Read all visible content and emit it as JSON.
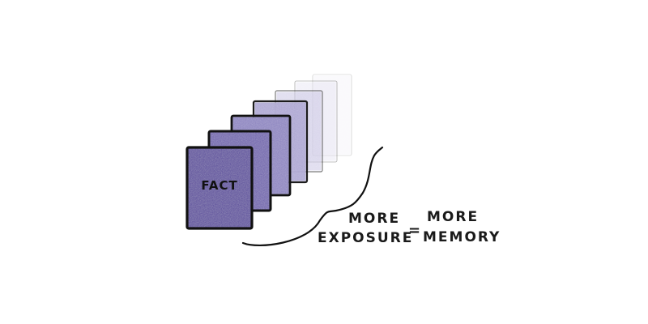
{
  "fact_card": {
    "label": "FACT",
    "color": "#5a4a9c"
  },
  "cards": [
    {
      "color": "#5a4a9c"
    },
    {
      "color": "#6f62ad"
    },
    {
      "color": "#8b82c0"
    },
    {
      "color": "#aaa3d2"
    },
    {
      "color": "#c6c1e2"
    },
    {
      "color": "#dcd9ee"
    },
    {
      "color": "#ebe9f5"
    }
  ],
  "equation": {
    "left_line1": "MORE",
    "left_line2": "EXPOSURE",
    "operator": "=",
    "right_line1": "MORE",
    "right_line2": "MEMORY"
  },
  "outline_color": "#111111"
}
